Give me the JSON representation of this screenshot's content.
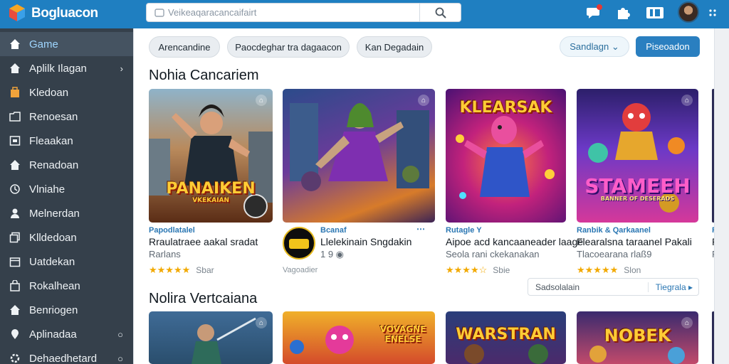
{
  "app": {
    "title": "Bogluacon"
  },
  "search": {
    "placeholder": "Veikeaqaracancaifairt"
  },
  "sidebar": {
    "items": [
      {
        "label": "Game",
        "trail": ""
      },
      {
        "label": "Aplilk Ilagan",
        "trail": "›"
      },
      {
        "label": "Kledoan",
        "trail": ""
      },
      {
        "label": "Renoesan",
        "trail": ""
      },
      {
        "label": "Fleaakan",
        "trail": ""
      },
      {
        "label": "Renadoan",
        "trail": ""
      },
      {
        "label": "Vlniahe",
        "trail": ""
      },
      {
        "label": "Melnerdan",
        "trail": ""
      },
      {
        "label": "Klldedoan",
        "trail": ""
      },
      {
        "label": "Uatdekan",
        "trail": ""
      },
      {
        "label": "Rokalhean",
        "trail": ""
      },
      {
        "label": "Benriogen",
        "trail": ""
      },
      {
        "label": "Aplinadaa",
        "trail": "○"
      },
      {
        "label": "Dehaedhetard",
        "trail": "○"
      }
    ]
  },
  "filters": {
    "chips": [
      "Arencandine",
      "Paocdeghar tra dagaacon",
      "Kan Degadain"
    ],
    "sort_label": "Sandlagn ⌄",
    "primary_label": "Piseoadon"
  },
  "sections": {
    "first_title": "Nohia Cancariem",
    "second_title": "Nolira Vertcaiana"
  },
  "cards": [
    {
      "art_title": "PANAIKEN",
      "art_subtitle": "VKEKAIAN",
      "category": "Papodlatalel",
      "name": "Rraulatraee aakal sradat",
      "sub": "Rarlans",
      "stars": "★★★★★",
      "rating": "Sbar"
    },
    {
      "art_title": "",
      "art_subtitle": "",
      "category": "Bcanaf",
      "name": "Llelekinain Sngdakin",
      "sub": "1 9  ◉",
      "stars": "",
      "rating": "Vagoadier",
      "more": "⋯"
    },
    {
      "art_title": "KLEARSAK",
      "art_subtitle": "",
      "category": "Rutagle Y",
      "name": "Aipoe acd kancaaneader laage",
      "sub": "Seola rani ckekanakan",
      "stars": "★★★★☆",
      "rating": "Sbie"
    },
    {
      "art_title": "STAMEEH",
      "art_subtitle": "BANNER OF DESERADS",
      "category": "Ranbik & Qarkaanel",
      "name": "Flearalsna taraanel Pakali",
      "sub": "Tlacoearana rlaß9",
      "stars": "★★★★★",
      "rating": "Slon"
    },
    {
      "art_title": "",
      "art_subtitle": "",
      "category": "R",
      "name": "R",
      "sub": "R",
      "stars": "",
      "rating": ""
    }
  ],
  "second_row": [
    {
      "art_title": ""
    },
    {
      "art_title": "VOVAGNE ENELSE"
    },
    {
      "art_title": "WARSTRAN"
    },
    {
      "art_title": "NOBEK"
    }
  ],
  "mini_box": {
    "left": "Sadsolalain",
    "right": "Tiegrala ▸"
  },
  "colors": {
    "topbar": "#1f7fc1",
    "sidebar": "#35404b",
    "accent": "#2a7fc0",
    "star": "#f2a900"
  }
}
